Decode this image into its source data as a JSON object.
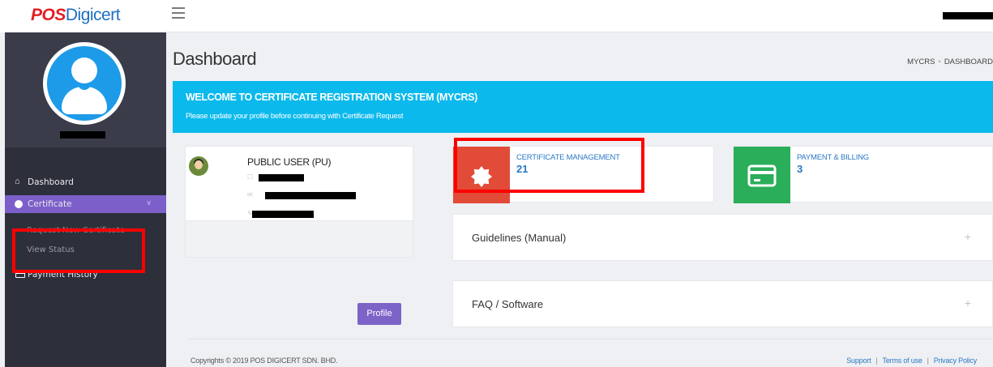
{
  "brand": {
    "pos": "POS",
    "digi": "Digicert"
  },
  "sidebar": {
    "items": [
      {
        "label": "Dashboard",
        "icon": "home-icon"
      },
      {
        "label": "Certificate",
        "icon": "circle-icon"
      },
      {
        "label": "Request New Certificate"
      },
      {
        "label": "View Status"
      },
      {
        "label": "Payment History",
        "icon": "card-icon"
      }
    ]
  },
  "header": {
    "title": "Dashboard",
    "breadcrumb": [
      "MYCRS",
      "DASHBOARD"
    ]
  },
  "banner": {
    "title": "WELCOME TO CERTIFICATE REGISTRATION SYSTEM (MYCRS)",
    "subtitle": "Please update your profile before continuing with Certificate Request"
  },
  "profile": {
    "name": "PUBLIC USER (PU)",
    "button": "Profile"
  },
  "stats": [
    {
      "label": "CERTIFICATE MANAGEMENT",
      "value": "21",
      "color": "#e14b38",
      "icon": "badge-icon"
    },
    {
      "label": "PAYMENT & BILLING",
      "value": "3",
      "color": "#2bae5a",
      "icon": "credit-card-icon"
    }
  ],
  "accordions": [
    {
      "title": "Guidelines (Manual)",
      "toggle": "+"
    },
    {
      "title": "FAQ / Software",
      "toggle": "+"
    }
  ],
  "footer": {
    "copyright": "Copyrights © 2019 POS DIGICERT SDN. BHD.",
    "links": [
      "Support",
      "Terms of use",
      "Privacy Policy"
    ]
  },
  "colors": {
    "accent": "#7c5fc9",
    "banner": "#0bb9ec",
    "sidebar": "#2d2f3b",
    "highlight": "#ff0000"
  }
}
